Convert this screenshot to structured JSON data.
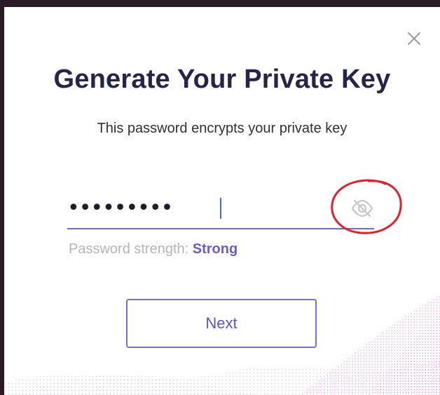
{
  "modal": {
    "title": "Generate Your Private Key",
    "subtitle": "This password encrypts your private key",
    "password_value": "•••••••••",
    "strength_label": "Password strength:",
    "strength_value": "Strong",
    "next_label": "Next"
  },
  "icons": {
    "close": "close-icon",
    "visibility": "eye-off-icon"
  },
  "colors": {
    "title": "#262449",
    "accent": "#6a5bd0",
    "annotation": "#e0202a"
  }
}
